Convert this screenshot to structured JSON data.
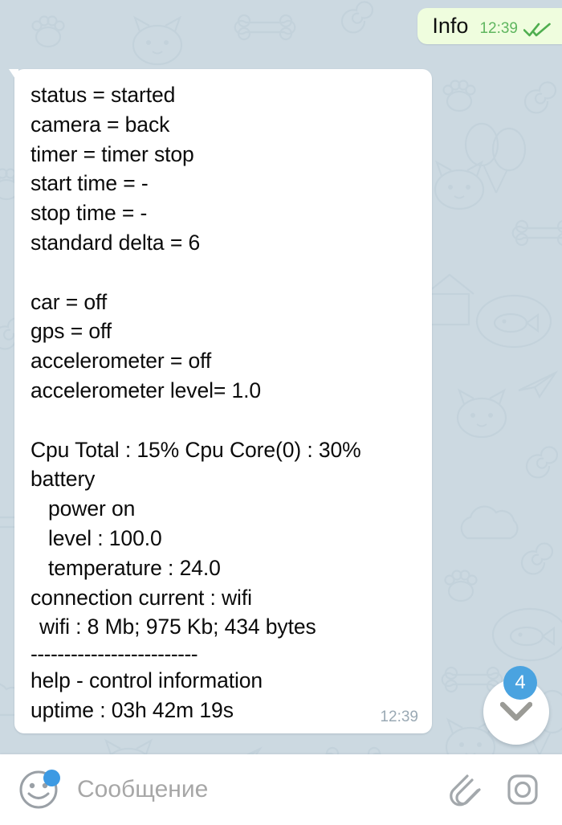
{
  "app": {
    "platform": "telegram-android",
    "colors": {
      "chat_background": "#ccd9e1",
      "outgoing_bubble": "#effdde",
      "incoming_bubble": "#ffffff",
      "accent_blue": "#4aa3e0",
      "check_green": "#4fae4f",
      "time_green": "#5fb65f",
      "time_gray": "#9aa9b4"
    }
  },
  "messages": [
    {
      "direction": "outgoing",
      "text": "Info",
      "time": "12:39",
      "status": "read",
      "status_icon": "double-check-icon"
    },
    {
      "direction": "incoming",
      "time": "12:39",
      "lines": [
        "status = started",
        "camera = back",
        "timer = timer stop",
        "start time = -",
        "stop time = -",
        "standard delta = 6",
        "",
        "car = off",
        "gps = off",
        "accelerometer = off",
        "accelerometer level= 1.0",
        "",
        "Cpu Total : 15% Cpu Core(0) : 30%",
        "battery",
        "power on",
        "level : 100.0",
        "temperature : 24.0",
        "connection current : wifi",
        "wifi : 8 Mb; 975 Kb; 434 bytes",
        "-------------------------",
        "help - control information",
        "uptime : 03h 42m 19s"
      ],
      "parsed": {
        "status": "started",
        "camera": "back",
        "timer": "timer stop",
        "start_time": "-",
        "stop_time": "-",
        "standard_delta": "6",
        "car": "off",
        "gps": "off",
        "accelerometer": "off",
        "accelerometer_level": "1.0",
        "cpu_total": "15%",
        "cpu_core_0": "30%",
        "battery_power": "on",
        "battery_level": "100.0",
        "battery_temperature": "24.0",
        "connection_current": "wifi",
        "wifi_traffic": "8 Mb; 975 Kb; 434 bytes",
        "help": "help - control information",
        "uptime": "03h 42m 19s"
      }
    }
  ],
  "scroll_down": {
    "icon": "chevron-down-icon",
    "unread_count": "4"
  },
  "composer": {
    "emoji_icon": "smiley-icon",
    "emoji_badge": true,
    "placeholder": "Сообщение",
    "value": "",
    "attach_icon": "paperclip-icon",
    "camera_icon": "camera-icon"
  }
}
